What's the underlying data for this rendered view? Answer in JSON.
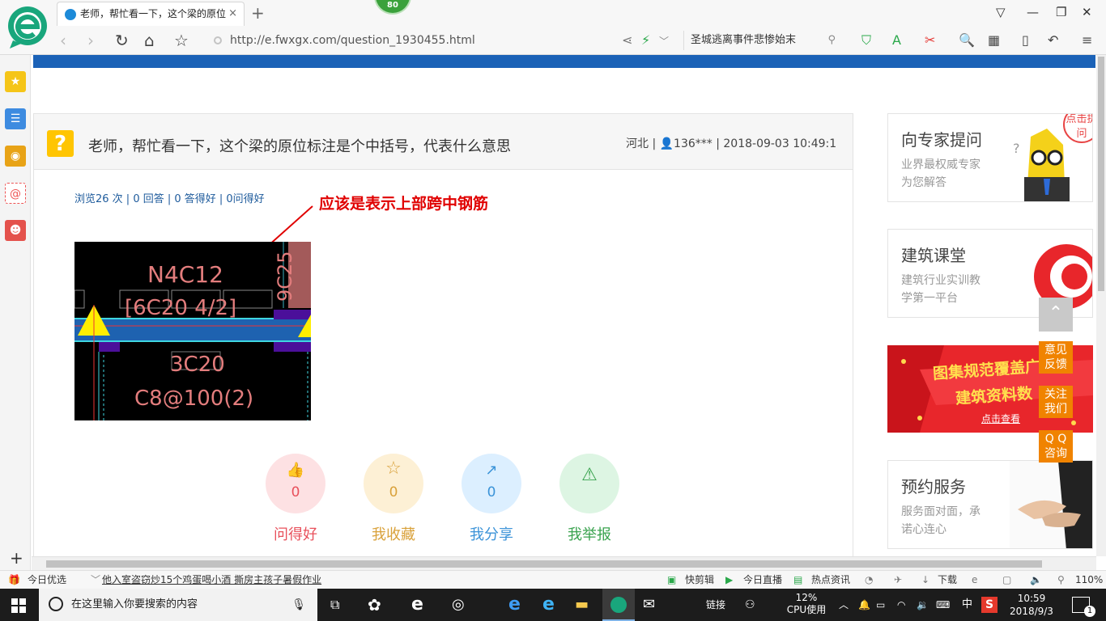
{
  "browser": {
    "score_badge": "80",
    "tab_title": "老师，帮忙看一下，这个梁的原位",
    "tab_close": "×",
    "new_tab": "+",
    "url": "http://e.fwxgx.com/question_1930455.html",
    "search_text": "圣城逃离事件悲惨始末",
    "left_sidebar_plus": "+"
  },
  "question": {
    "title": "老师，帮忙看一下，这个梁的原位标注是个中括号，代表什么意思",
    "meta": "河北 | 👤136*** | 2018-09-03 10:49:1",
    "stats": "浏览26 次 | 0 回答 | 0 答得好 | 0问得好",
    "annotation": "应该是表示上部跨中钢筋",
    "cad": {
      "top_mark": "N4C12",
      "bracket_mark": "[6C20 4/2]",
      "side_mark": "9C25",
      "bottom_mark": "3C20",
      "stirrup_mark": "C8@100(2)"
    }
  },
  "actions": [
    {
      "label": "问得好",
      "count": "0",
      "color": "#e8505b",
      "bg": "#fde1e3",
      "icon": "👍"
    },
    {
      "label": "我收藏",
      "count": "0",
      "color": "#d9a13a",
      "bg": "#fdf0d5",
      "icon": "☆"
    },
    {
      "label": "我分享",
      "count": "0",
      "color": "#3b93d8",
      "bg": "#dcefff",
      "icon": "↗"
    },
    {
      "label": "我举报",
      "count": "0",
      "color": "#3aa34f",
      "bg": "#ddf5e3",
      "icon": "⚠"
    }
  ],
  "sidebar_cards": {
    "expert": {
      "title": "向专家提问",
      "line1": "业界最权威专家",
      "line2": "为您解答",
      "bubble": "点击提问"
    },
    "classroom": {
      "title": "建筑课堂",
      "line1": "建筑行业实训教",
      "line2": "学第一平台"
    },
    "banner": {
      "line1": "图集规范覆盖广",
      "line2": "建筑资料数",
      "button": "点击查看"
    },
    "service": {
      "title": "预约服务",
      "line1": "服务面对面，承",
      "line2": "诺心连心"
    }
  },
  "float_tools": {
    "feedback": [
      "意见",
      "反馈"
    ],
    "follow": [
      "关注",
      "我们"
    ],
    "qq": [
      "Q Q",
      "咨询"
    ]
  },
  "statusbar": {
    "today": "今日优选",
    "headline": "他入室盗窃炒15个鸡蛋喝小酒 撕房主孩子暑假作业",
    "clip": "快剪辑",
    "live": "今日直播",
    "hot": "热点资讯",
    "download": "下载",
    "zoom": "110%"
  },
  "taskbar": {
    "search_placeholder": "在这里输入你要搜索的内容",
    "links": "链接",
    "cpu_pct": "12%",
    "cpu_label": "CPU使用",
    "ime": "中",
    "time": "10:59",
    "date": "2018/9/3",
    "notif_count": "1"
  }
}
